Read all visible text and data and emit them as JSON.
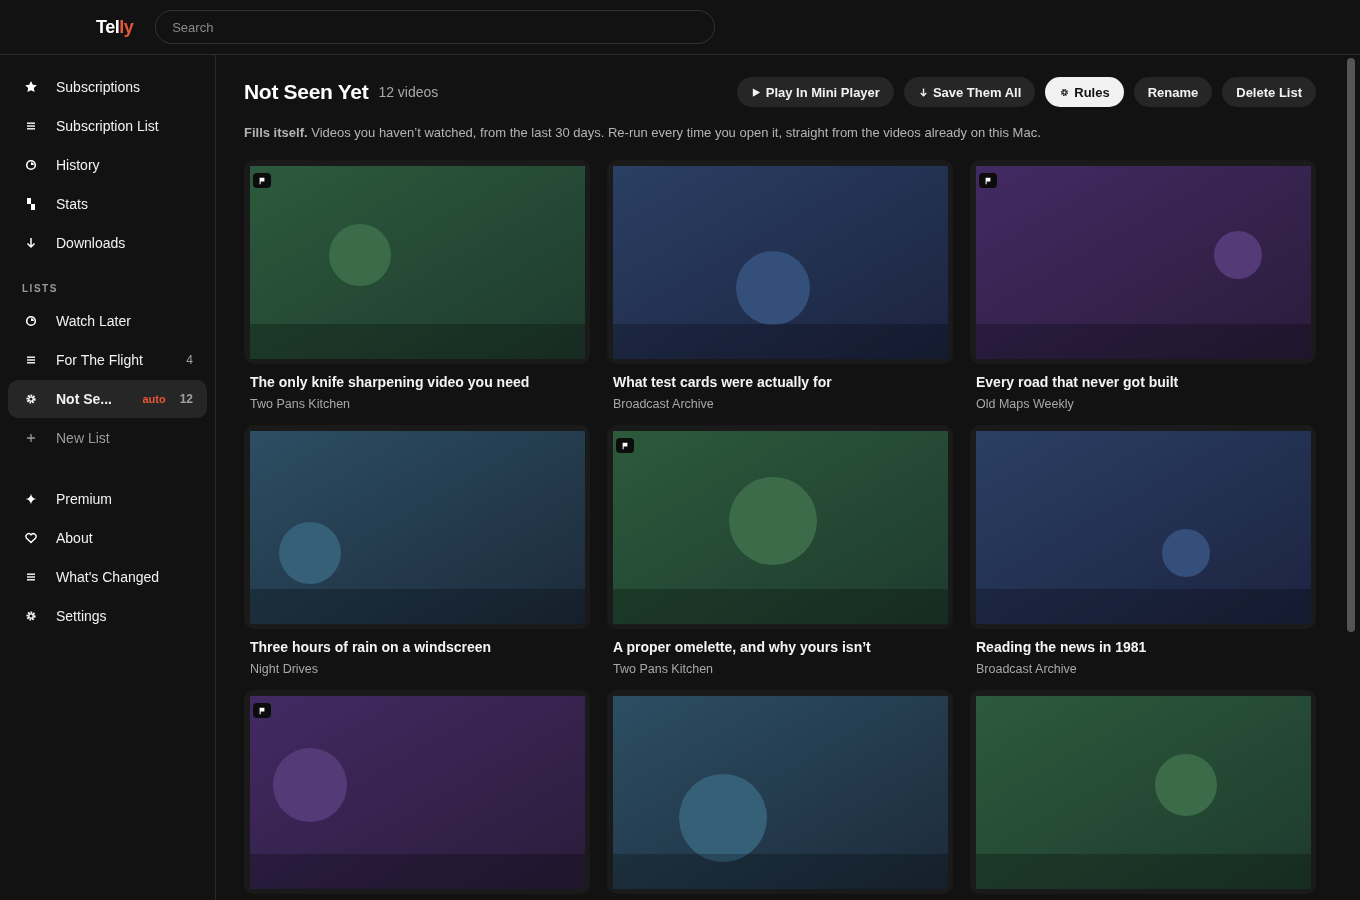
{
  "app": {
    "logo_main": "Tel",
    "logo_accent": "ly"
  },
  "search": {
    "placeholder": "Search"
  },
  "sidebar": {
    "items": [
      {
        "label": "Subscriptions",
        "selected": false
      },
      {
        "label": "Subscription List",
        "selected": false
      },
      {
        "label": "History",
        "selected": false
      },
      {
        "label": "Stats",
        "selected": false
      },
      {
        "label": "Downloads",
        "selected": false
      }
    ],
    "lists_heading": "LISTS",
    "lists": [
      {
        "label": "Watch Later",
        "selected": false
      },
      {
        "label": "For The Flight",
        "count": "4",
        "selected": false
      },
      {
        "label": "Not Se...",
        "tag": "auto",
        "count": "12",
        "selected": true
      },
      {
        "label": "New List",
        "kind": "add",
        "selected": false
      }
    ],
    "footer": [
      {
        "label": "Premium"
      },
      {
        "label": "About"
      },
      {
        "label": "What's Changed"
      },
      {
        "label": "Settings"
      }
    ]
  },
  "main": {
    "title": "Not Seen Yet",
    "count": "12 videos",
    "buttons": [
      {
        "label": "Play In Mini Player",
        "selected": false
      },
      {
        "label": "Save Them All",
        "selected": false
      },
      {
        "label": "Rules",
        "selected": true
      },
      {
        "label": "Rename",
        "selected": false
      },
      {
        "label": "Delete List",
        "selected": false
      }
    ],
    "description": "**Fills itself.** Videos you haven’t watched, from the last 30 days. Re-run every time you open it, straight from the videos already on this Mac.",
    "videos": [
      {
        "title": "The only knife sharpening video you need",
        "channel": "Two Pans Kitchen",
        "flagged": true
      },
      {
        "title": "What test cards were actually for",
        "channel": "Broadcast Archive",
        "flagged": false
      },
      {
        "title": "Every road that never got built",
        "channel": "Old Maps Weekly",
        "flagged": true
      },
      {
        "title": "Three hours of rain on a windscreen",
        "channel": "Night Drives",
        "flagged": false
      },
      {
        "title": "A proper omelette, and why yours isn’t",
        "channel": "Two Pans Kitchen",
        "flagged": true
      },
      {
        "title": "Reading the news in 1981",
        "channel": "Broadcast Archive",
        "flagged": false
      },
      {
        "flagged": true
      },
      {
        "flagged": false
      },
      {
        "flagged": false
      }
    ]
  }
}
